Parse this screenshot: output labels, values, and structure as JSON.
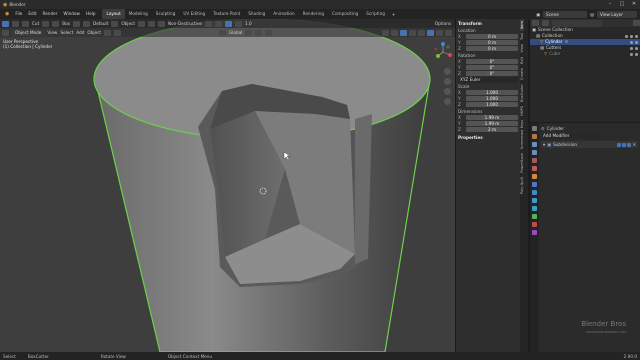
{
  "app": {
    "title": "Blender"
  },
  "window_controls": [
    "–",
    "□",
    "✕"
  ],
  "menu": [
    "File",
    "Edit",
    "Render",
    "Window",
    "Help"
  ],
  "workspaces": [
    "Layout",
    "Modeling",
    "Sculpting",
    "UV Editing",
    "Texture Paint",
    "Shading",
    "Animation",
    "Rendering",
    "Compositing",
    "Scripting"
  ],
  "active_workspace": "Layout",
  "scene": {
    "label": "Scene",
    "view_layer": "View Layer"
  },
  "tool_header": {
    "cut_label": "Cut",
    "box_label": "Box",
    "orientation_label": "Default",
    "global_label": "Global",
    "nondestructive_label": "Non-Destructive",
    "object_label": "Object",
    "zoom_label": "1.0"
  },
  "viewport_header": {
    "mode": "Object Mode",
    "menus": [
      "View",
      "Select",
      "Add",
      "Object"
    ],
    "options": "Options"
  },
  "viewport_info": {
    "line1": "User Perspective",
    "line2": "(1) Collection | Cylinder"
  },
  "transform": {
    "title": "Transform",
    "location_label": "Location",
    "location": [
      [
        "X",
        "0 m"
      ],
      [
        "Y",
        "0 m"
      ],
      [
        "Z",
        "0 m"
      ]
    ],
    "rotation_label": "Rotation",
    "rotation": [
      [
        "X",
        "0°"
      ],
      [
        "Y",
        "0°"
      ],
      [
        "Z",
        "0°"
      ]
    ],
    "rotation_mode": "XYZ Euler",
    "scale_label": "Scale",
    "scale": [
      [
        "X",
        "1.000"
      ],
      [
        "Y",
        "1.000"
      ],
      [
        "Z",
        "1.000"
      ]
    ],
    "dimensions_label": "Dimensions",
    "dimensions": [
      [
        "X",
        "1.99 m"
      ],
      [
        "Y",
        "1.99 m"
      ],
      [
        "Z",
        "2 m"
      ]
    ],
    "properties_title": "Properties"
  },
  "sidebar_tabs": [
    "Item",
    "Tool",
    "View",
    "Edit",
    "Create",
    "BoxCutter",
    "HOPS",
    "Screencast Keys",
    "PowerSave",
    "Poly Quilt"
  ],
  "active_sidebar_tab": "Item",
  "outliner": {
    "items": [
      {
        "label": "Scene Collection",
        "indent": 0,
        "selected": false
      },
      {
        "label": "Collection",
        "indent": 1,
        "selected": false
      },
      {
        "label": "Cylinder",
        "indent": 2,
        "selected": true
      },
      {
        "label": "Cutters",
        "indent": 2,
        "selected": false
      },
      {
        "label": "Cube",
        "indent": 3,
        "selected": false
      }
    ]
  },
  "properties": {
    "object_name": "Cylinder",
    "add_modifier": "Add Modifier",
    "modifier": "Subdivision"
  },
  "watermark": {
    "brand": "Blender Bros",
    "tagline": "WWW.BLENDERBROS.COM"
  },
  "status_bar": {
    "select": "Select",
    "boxcutter": "BoxCutter",
    "rotate": "Rotate View",
    "context": "Object Context Menu",
    "version": "2.90.0"
  },
  "colors": {
    "accent": "#4772b3",
    "selection_outline": "#6bd14a",
    "viewport_bg": "#3e3e3e"
  }
}
